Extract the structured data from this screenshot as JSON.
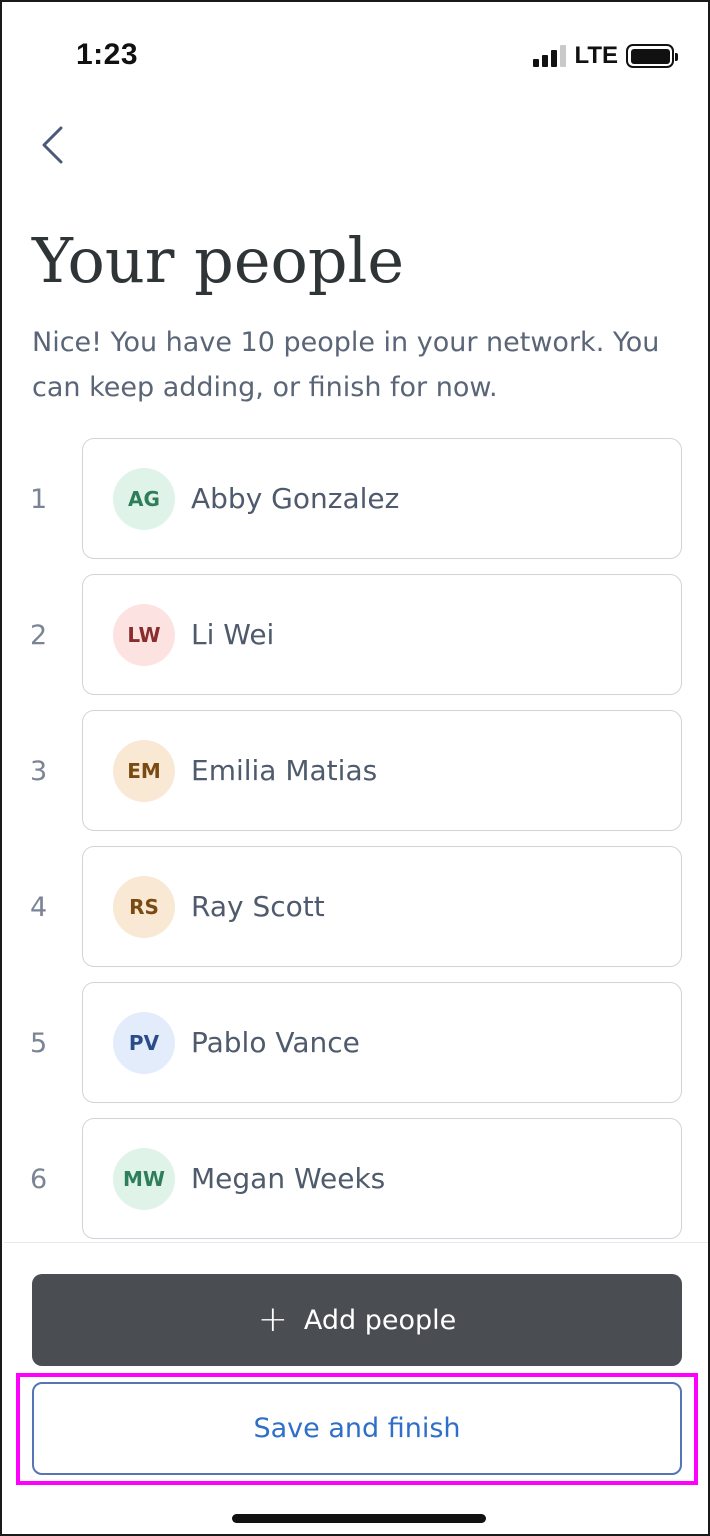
{
  "status_bar": {
    "time": "1:23",
    "network": "LTE",
    "signal_bars": 3,
    "signal_total": 4
  },
  "header": {
    "back_icon": "chevron-left-icon",
    "title": "Your people"
  },
  "subtitle": "Nice! You have 10 people in your network. You can keep adding, or finish for now.",
  "people": [
    {
      "number": "1",
      "initials": "AG",
      "name": "Abby Gonzalez",
      "avatar_bg": "#dff3e8",
      "avatar_fg": "#2e7d5b"
    },
    {
      "number": "2",
      "initials": "LW",
      "name": "Li Wei",
      "avatar_bg": "#fde2e2",
      "avatar_fg": "#8b2c2c"
    },
    {
      "number": "3",
      "initials": "EM",
      "name": "Emilia Matias",
      "avatar_bg": "#f8e8d4",
      "avatar_fg": "#7a4a12"
    },
    {
      "number": "4",
      "initials": "RS",
      "name": "Ray Scott",
      "avatar_bg": "#f8e8d4",
      "avatar_fg": "#7a4a12"
    },
    {
      "number": "5",
      "initials": "PV",
      "name": "Pablo Vance",
      "avatar_bg": "#e3ecfb",
      "avatar_fg": "#2b4c8a"
    },
    {
      "number": "6",
      "initials": "MW",
      "name": "Megan Weeks",
      "avatar_bg": "#dff3e8",
      "avatar_fg": "#2e7d5b"
    }
  ],
  "actions": {
    "add_label": "Add people",
    "add_icon": "plus-icon",
    "save_label": "Save and finish",
    "highlight_color": "#ff00ff"
  }
}
